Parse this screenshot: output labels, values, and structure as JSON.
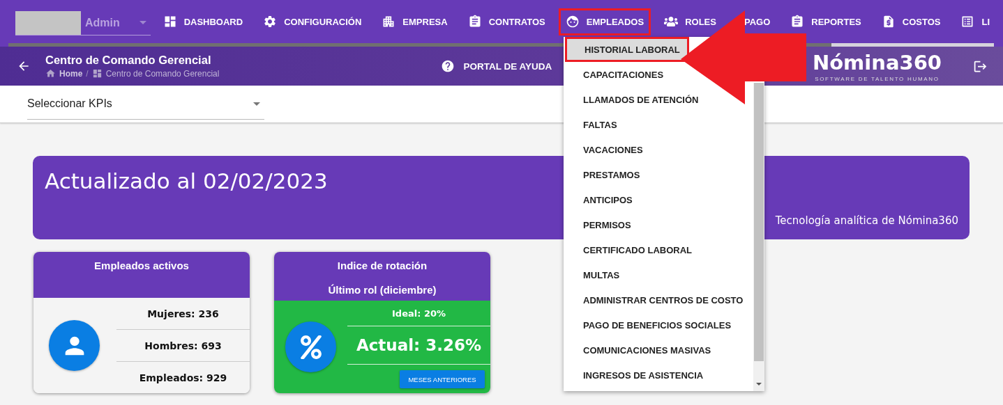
{
  "user_select": {
    "value": "Admin"
  },
  "nav": [
    {
      "label": "DASHBOARD",
      "selected": false
    },
    {
      "label": "CONFIGURACIÓN",
      "selected": false
    },
    {
      "label": "EMPRESA",
      "selected": false
    },
    {
      "label": "CONTRATOS",
      "selected": false
    },
    {
      "label": "EMPLEADOS",
      "selected": true
    },
    {
      "label": "ROLES",
      "label_after": "PAGO",
      "selected": false
    },
    {
      "label": "REPORTES",
      "selected": false
    },
    {
      "label": "COSTOS",
      "selected": false
    },
    {
      "label": "LI",
      "selected": false
    }
  ],
  "progress": {
    "level": 0.835
  },
  "page_header": {
    "title": "Centro de Comando Gerencial",
    "breadcrumbs": [
      "Home",
      "Centro de Comando Gerencial"
    ],
    "breadcrumb_separator": "/",
    "help_button": "PORTAL DE AYUDA",
    "logo": {
      "name": "Nómina360",
      "tagline": "SOFTWARE DE TALENTO HUMANO"
    }
  },
  "kpi_select": {
    "value": "Seleccionar KPIs"
  },
  "banner": {
    "title": "Actualizado al 02/02/2023",
    "subtitle": "Tecnología analítica de Nómina360"
  },
  "cards": [
    {
      "kind": "employees",
      "title": "Empleados activos",
      "stats": [
        "Mujeres: 236",
        "Hombres: 693",
        "Empleados: 929"
      ]
    },
    {
      "kind": "rotation",
      "title": "Indice de rotación",
      "subtitle": "Último rol (diciembre)",
      "ideal": "Ideal: 20%",
      "actual": "Actual: 3.26%",
      "button": "MESES ANTERIORES"
    }
  ],
  "dropdown_menu": [
    {
      "label": "HISTORIAL LABORAL",
      "selected": true
    },
    {
      "label": "CAPACITACIONES",
      "selected": false
    },
    {
      "label": "LLAMADOS DE ATENCIÓN",
      "selected": false
    },
    {
      "label": "FALTAS",
      "selected": false
    },
    {
      "label": "VACACIONES",
      "selected": false
    },
    {
      "label": "PRESTAMOS",
      "selected": false
    },
    {
      "label": "ANTICIPOS",
      "selected": false
    },
    {
      "label": "PERMISOS",
      "selected": false
    },
    {
      "label": "CERTIFICADO LABORAL",
      "selected": false
    },
    {
      "label": "MULTAS",
      "selected": false
    },
    {
      "label": "ADMINISTRAR CENTROS DE COSTO",
      "selected": false
    },
    {
      "label": "PAGO DE BENEFICIOS SOCIALES",
      "selected": false
    },
    {
      "label": "COMUNICACIONES MASIVAS",
      "selected": false
    },
    {
      "label": "INGRESOS DE ASISTENCIA",
      "selected": false
    }
  ]
}
